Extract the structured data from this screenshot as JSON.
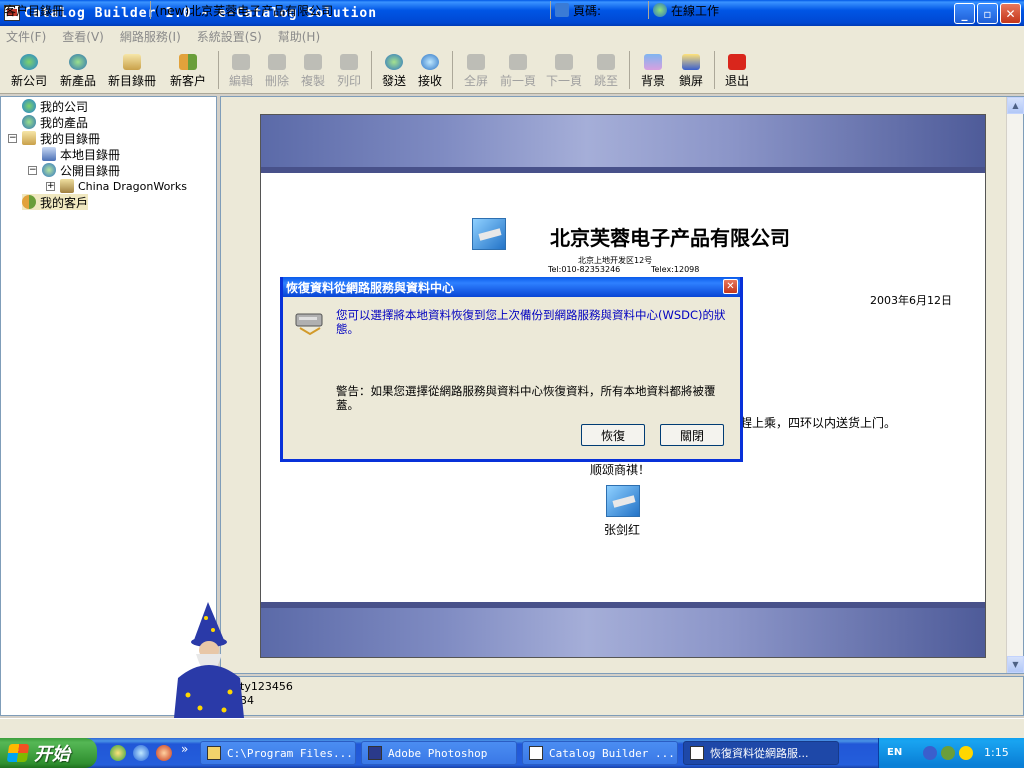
{
  "window": {
    "title": "Catalog Builder 1.0 - e-Catalog Solution"
  },
  "menu": {
    "items": [
      {
        "label": "文件(F)"
      },
      {
        "label": "查看(V)"
      },
      {
        "label": "網路服務(I)"
      },
      {
        "label": "系統設置(S)"
      },
      {
        "label": "幫助(H)"
      }
    ]
  },
  "toolbar": {
    "new_company": "新公司",
    "new_product": "新產品",
    "new_catalog": "新目錄冊",
    "new_customer": "新客户",
    "edit": "編輯",
    "delete": "刪除",
    "copy": "複製",
    "print": "列印",
    "send": "發送",
    "receive": "接收",
    "fullscreen": "全屏",
    "prev_page": "前一頁",
    "next_page": "下一頁",
    "goto": "跳至",
    "background": "背景",
    "lock_screen": "鎖屏",
    "exit": "退出"
  },
  "tree": {
    "my_company": "我的公司",
    "my_products": "我的產品",
    "my_catalogs": "我的目錄冊",
    "local_catalogs": "本地目錄冊",
    "public_catalogs": "公開目錄冊",
    "china_dragonworks": "China DragonWorks",
    "my_customers": "我的客戶"
  },
  "document": {
    "company_name": "北京芙蓉电子产品有限公司",
    "address": "北京上地开发区12号",
    "tel": "Tel:010-82353246",
    "telex": "Telex:12098",
    "date": "2003年6月12日",
    "body_line": "趕上乘，四环以内送货上门。",
    "regards": "顺颂商祺！",
    "signer": "张剑红"
  },
  "info": {
    "line1": "ty123456",
    "line2": "34"
  },
  "status": {
    "panel1": "客户目錄冊",
    "panel2": "(new)北京芙蓉电子产品有限公司",
    "panel3": "頁碼:",
    "panel4": "在線工作"
  },
  "taskbar": {
    "start_label": "开始",
    "more": "»",
    "tasks": [
      {
        "label": "C:\\Program Files..."
      },
      {
        "label": "Adobe Photoshop"
      },
      {
        "label": "Catalog Builder ..."
      },
      {
        "label": "恢復資料從網路服..."
      }
    ],
    "lang": "EN",
    "clock": "1:15"
  },
  "dialog": {
    "title": "恢復資料從網路服務與資料中心",
    "message": "您可以選擇將本地資料恢復到您上次備份到網路服務與資料中心(WSDC)的狀態。",
    "warning": "警告：如果您選擇從網路服務與資料中心恢復資料，所有本地資料都將被覆蓋。",
    "restore_button": "恢復",
    "close_button": "關閉"
  },
  "colors": {
    "titlebar": "#0055e5",
    "dialog_message": "#0000c0",
    "taskbar": "#245edb",
    "start_button": "#3c9e3c"
  }
}
